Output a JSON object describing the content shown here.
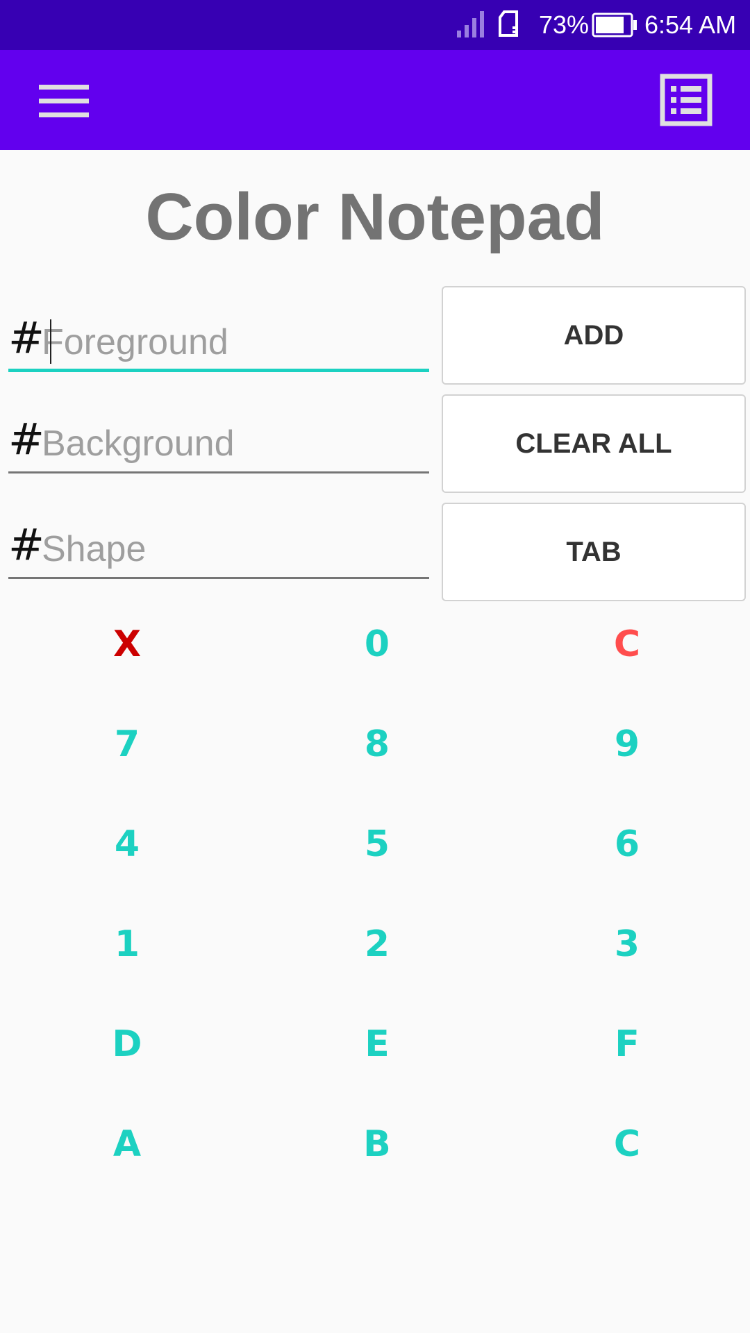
{
  "status_bar": {
    "battery_percent": "73%",
    "time": "6:54 AM",
    "icons": [
      "signal-icon",
      "sim-card-icon",
      "battery-icon"
    ]
  },
  "app_bar": {
    "menu_icon": "hamburger-menu-icon",
    "list_icon": "list-view-icon",
    "background_color": "#6200ee"
  },
  "title": "Color Notepad",
  "fields": [
    {
      "prefix": "#",
      "value": "",
      "placeholder": "Foreground",
      "focused": true
    },
    {
      "prefix": "#",
      "value": "",
      "placeholder": "Background",
      "focused": false
    },
    {
      "prefix": "#",
      "value": "",
      "placeholder": "Shape",
      "focused": false
    }
  ],
  "buttons": {
    "add": "ADD",
    "clear_all": "CLEAR ALL",
    "tab": "TAB"
  },
  "keypad": {
    "rows": [
      [
        "X",
        "0",
        "C"
      ],
      [
        "7",
        "8",
        "9"
      ],
      [
        "4",
        "5",
        "6"
      ],
      [
        "1",
        "2",
        "3"
      ],
      [
        "D",
        "E",
        "F"
      ],
      [
        "A",
        "B",
        "C"
      ]
    ],
    "colors": {
      "delete": "#cc0000",
      "clear": "#ff4d4d",
      "digit": "#1cd1c1"
    }
  }
}
